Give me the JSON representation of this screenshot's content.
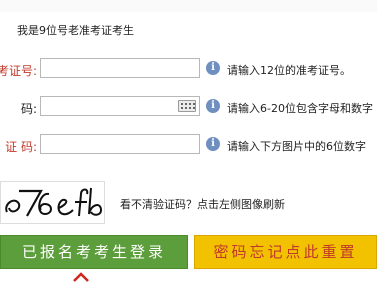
{
  "note": "我是9位号老准考证考生",
  "fields": [
    {
      "label": "考证号:",
      "value": "",
      "hint": "请输入12位的准考证号。",
      "info_icon": "info-icon"
    },
    {
      "label": "码:",
      "value": "",
      "hint": "请输入6-20位包含字母和数字",
      "info_icon": "info-icon",
      "keyboard_icon": "keyboard-icon"
    },
    {
      "label": "证 码:",
      "value": "",
      "hint": "请输入下方图片中的6位数字",
      "info_icon": "info-icon"
    }
  ],
  "captcha": {
    "text": "76efb",
    "tip": "看不清验证码？点击左侧图像刷新"
  },
  "buttons": {
    "login": "已报名考考生登录",
    "forgot": "密码忘记点此重置"
  },
  "colors": {
    "accent_red": "#c0392b",
    "green": "#5d9e3c",
    "yellow": "#f2c100"
  }
}
